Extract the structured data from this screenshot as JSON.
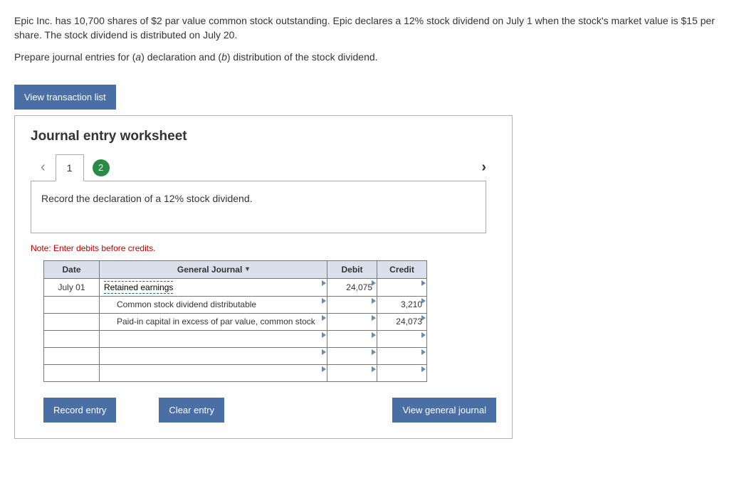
{
  "question": {
    "para1": "Epic Inc. has 10,700 shares of $2 par value common stock outstanding. Epic declares a 12% stock dividend on July 1 when the stock's market value is $15 per share. The stock dividend is distributed on July 20.",
    "para2_before": "Prepare journal entries for (",
    "para2_a_label": "a",
    "para2_mid": ") declaration and (",
    "para2_b_label": "b",
    "para2_after": ") distribution of the stock dividend."
  },
  "buttons": {
    "view_transaction_list": "View transaction list",
    "record_entry": "Record entry",
    "clear_entry": "Clear entry",
    "view_general_journal": "View general journal"
  },
  "worksheet": {
    "title": "Journal entry worksheet",
    "tab1": "1",
    "tab2": "2",
    "instruction": "Record the declaration of a 12% stock dividend.",
    "note": "Note: Enter debits before credits."
  },
  "table": {
    "headers": {
      "date": "Date",
      "gj": "General Journal",
      "debit": "Debit",
      "credit": "Credit"
    },
    "rows": [
      {
        "date": "July 01",
        "account": "Retained earnings",
        "debit": "24,075",
        "credit": "",
        "indent": 0,
        "dotted": true
      },
      {
        "date": "",
        "account": "Common stock dividend distributable",
        "debit": "",
        "credit": "3,210",
        "indent": 1,
        "dotted": false
      },
      {
        "date": "",
        "account": "Paid-in capital in excess of par value, common stock",
        "debit": "",
        "credit": "24,073",
        "indent": 1,
        "dotted": false
      },
      {
        "date": "",
        "account": "",
        "debit": "",
        "credit": "",
        "indent": 0,
        "dotted": false
      },
      {
        "date": "",
        "account": "",
        "debit": "",
        "credit": "",
        "indent": 0,
        "dotted": false
      },
      {
        "date": "",
        "account": "",
        "debit": "",
        "credit": "",
        "indent": 0,
        "dotted": false
      }
    ]
  }
}
